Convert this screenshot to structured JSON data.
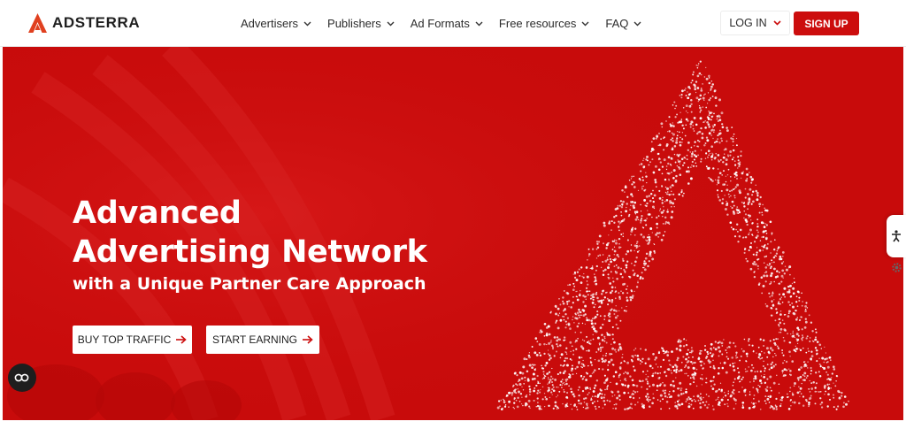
{
  "brand": {
    "name": "ADSTERRA",
    "accent_color": "#cc0d0d",
    "logo_icon": "adsterra-logo-icon"
  },
  "nav": {
    "items": [
      {
        "label": "Advertisers"
      },
      {
        "label": "Publishers"
      },
      {
        "label": "Ad Formats"
      },
      {
        "label": "Free resources"
      },
      {
        "label": "FAQ"
      }
    ],
    "login_label": "LOG IN",
    "signup_label": "SIGN UP"
  },
  "hero": {
    "title_line1": "Advanced",
    "title_line2": "Advertising Network",
    "subtitle": "with a Unique Partner Care Approach",
    "buttons": [
      {
        "label": "BUY TOP TRAFFIC",
        "icon": "arrow-right-icon"
      },
      {
        "label": "START EARNING",
        "icon": "arrow-right-icon"
      }
    ],
    "background_color": "#c80b0b"
  },
  "widgets": {
    "accessibility_icon": "accessibility-icon",
    "settings_icon": "gear-icon",
    "cookie_icon": "cookie-consent-icon"
  }
}
